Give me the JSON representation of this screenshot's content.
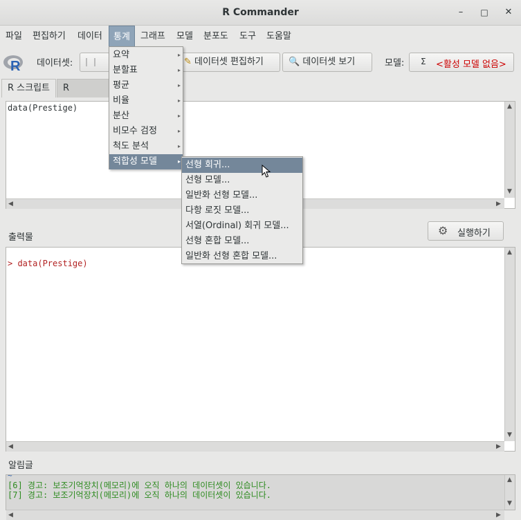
{
  "window": {
    "title": "R Commander",
    "minimize": "–",
    "maximize": "□",
    "close": "✕"
  },
  "menubar": [
    "파일",
    "편집하기",
    "데이터",
    "통계",
    "그래프",
    "모델",
    "분포도",
    "도구",
    "도움말"
  ],
  "toolbar": {
    "dataset_label": "데이터셋:",
    "edit_dataset": "데이터셋 편집하기",
    "view_dataset": "데이터셋 보기",
    "model_label": "모델:",
    "model_sigma": "Σ",
    "model_value": "<활성 모델 없음>",
    "model_value_color": "#cc0000"
  },
  "tabs": [
    "R 스크립트",
    "R Markdown"
  ],
  "script": {
    "content": "data(Prestige)"
  },
  "output": {
    "label": "출력물",
    "run_button": "실행하기",
    "content": "> data(Prestige)",
    "content_color": "#b22222"
  },
  "messages": {
    "label": "알림글",
    "lines": [
      "[6] 경고: 보조기억장치(메모리)에 오직 하나의 데이터셋이 있습니다.",
      "[7] 경고: 보조기억장치(메모리)에 오직 하나의 데이터셋이 있습니다."
    ],
    "color": "#2e8b20"
  },
  "stats_menu": {
    "items": [
      "요약",
      "분할표",
      "평균",
      "비율",
      "분산",
      "비모수 검정",
      "척도 분석",
      "적합성 모델"
    ],
    "highlighted": "적합성 모델"
  },
  "fit_models_submenu": {
    "items": [
      "선형 회귀...",
      "선형 모델...",
      "일반화 선형 모델...",
      "다항 로짓 모델...",
      "서열(Ordinal) 회귀 모델...",
      "선형 혼합 모델...",
      "일반화 선형 혼합 모델..."
    ],
    "highlighted": "선형 회귀..."
  },
  "colors": {
    "menu_highlight": "#74879a",
    "menu_active": "#8fa4b8"
  }
}
